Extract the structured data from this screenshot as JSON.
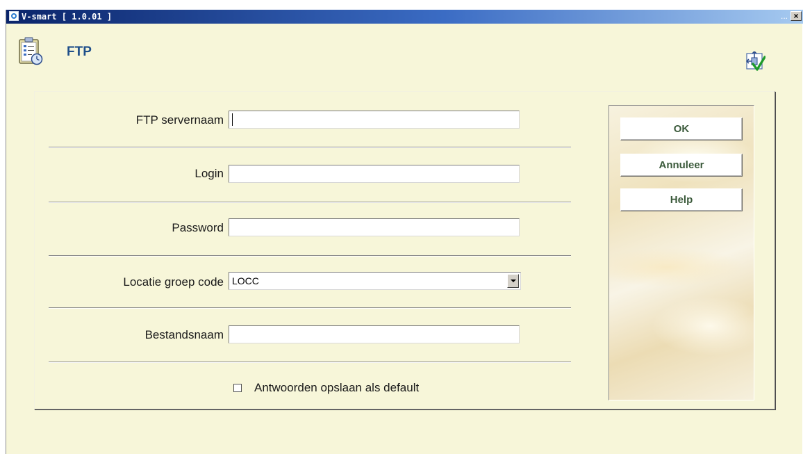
{
  "window": {
    "title": "V-smart [ 1.0.01 ]",
    "title_dots": "...",
    "close_label": "×"
  },
  "header": {
    "title": "FTP",
    "icon": "clipboard-clock-icon",
    "tool_icon": "move-checkmark-icon"
  },
  "form": {
    "fields": [
      {
        "label": "FTP servernaam",
        "value": ""
      },
      {
        "label": "Login",
        "value": ""
      },
      {
        "label": "Password",
        "value": ""
      },
      {
        "label": "Locatie groep code",
        "value": "LOCC"
      },
      {
        "label": "Bestandsnaam",
        "value": ""
      }
    ],
    "checkbox": {
      "label": "Antwoorden opslaan als default",
      "checked": false
    }
  },
  "buttons": {
    "ok": "OK",
    "cancel": "Annuleer",
    "help": "Help"
  },
  "colors": {
    "background": "#f7f6d9",
    "title_color": "#1f4f8a",
    "button_text": "#3b5a3b"
  }
}
